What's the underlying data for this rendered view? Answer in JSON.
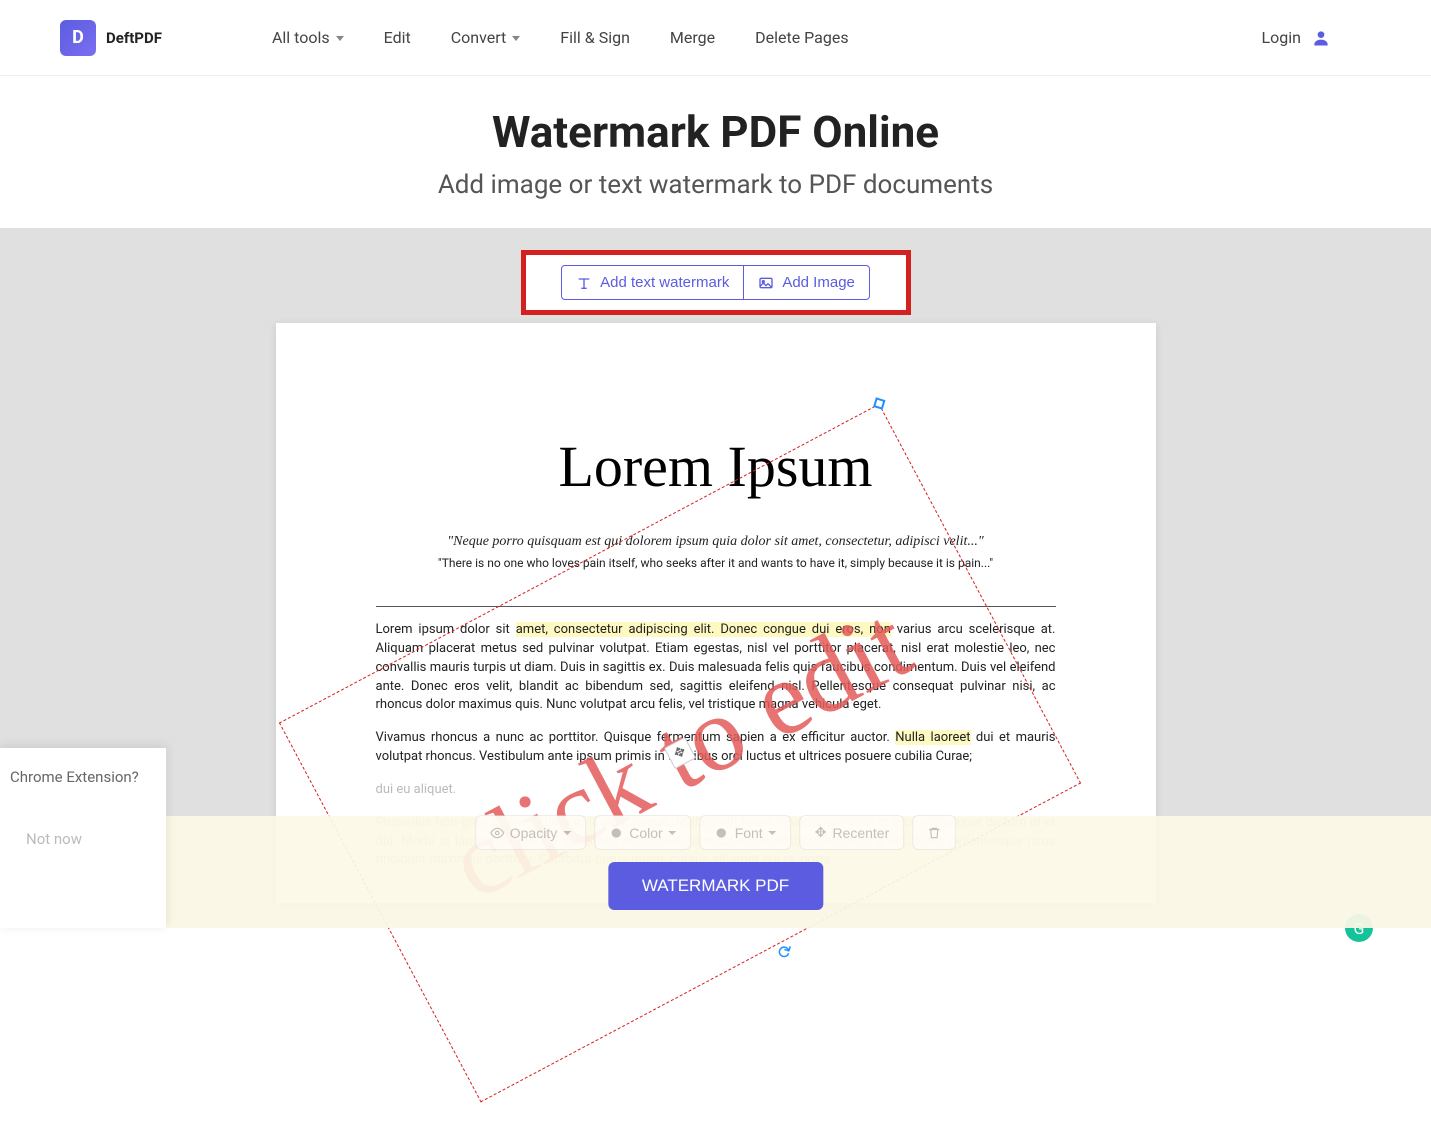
{
  "header": {
    "logo_letter": "D",
    "logo_text": "DeftPDF",
    "nav": {
      "all_tools": "All tools",
      "edit": "Edit",
      "convert": "Convert",
      "fill_sign": "Fill & Sign",
      "merge": "Merge",
      "delete_pages": "Delete Pages"
    },
    "login": "Login"
  },
  "title": {
    "main": "Watermark PDF Online",
    "sub": "Add image or text watermark to PDF documents"
  },
  "actions": {
    "add_text": "Add text watermark",
    "add_image": "Add Image"
  },
  "watermark": {
    "text": "click to edit"
  },
  "document": {
    "title": "Lorem Ipsum",
    "quote": "\"Neque porro quisquam est qui dolorem ipsum quia dolor sit amet, consectetur, adipisci velit...\"",
    "subquote": "\"There is no one who loves pain itself, who seeks after it and wants to have it, simply because it is pain...\"",
    "p1_pre": "Lorem ipsum dolor sit ",
    "p1_hl1": "amet, consectetur adipiscing elit. Donec congue dui eros, non",
    "p1_mid": " varius arcu scelerisque at. Aliquam placerat metus sed pulvinar volutpat. Etiam egestas, nisl vel porttitor placerat, nisl erat molestie leo, nec convallis mauris turpis ut diam. Duis in sagittis ex. Duis malesuada felis quis faucibus condimentum. Duis vel eleifend ante. Donec eros velit, blandit ac bibendum sed, sagittis eleifend nisl. Pellentesque consequat pulvinar nisi, ac rhoncus dolor maximus quis. Nunc volutpat arcu felis, vel tristique magna vehicula eget.",
    "p2_pre": "Vivamus rhoncus a nunc ac porttitor. Quisque fermentum sapien a ex efficitur auctor. ",
    "p2_hl": "Nulla laoreet",
    "p2_post": " dui et mauris volutpat rhoncus. Vestibulum ante ipsum primis in faucibus orci luctus et ultrices posuere cubilia Curae;",
    "p3_fade1": "dui eu aliquet.",
    "p3_fade2": "Phasellus non gravida erat. Etiam at laoreet neque. Nullam elit lorem, viverra non nibh at arcu malesuper dictum id et dui. Morbi at laoreet neque, vel venenatis nunc. Nisl selerisque, consectetur adipiscing elit. Nunc pellentesque risus tincidunt maximus porttitor. Curabitur purus quam, cursus sit amet dui et, porta"
  },
  "toolbar": {
    "opacity": "Opacity",
    "color": "Color",
    "font": "Font",
    "recenter": "Recenter"
  },
  "cta": "WATERMARK PDF",
  "popup": {
    "title": "Chrome Extension?",
    "notnow": "Not now"
  }
}
